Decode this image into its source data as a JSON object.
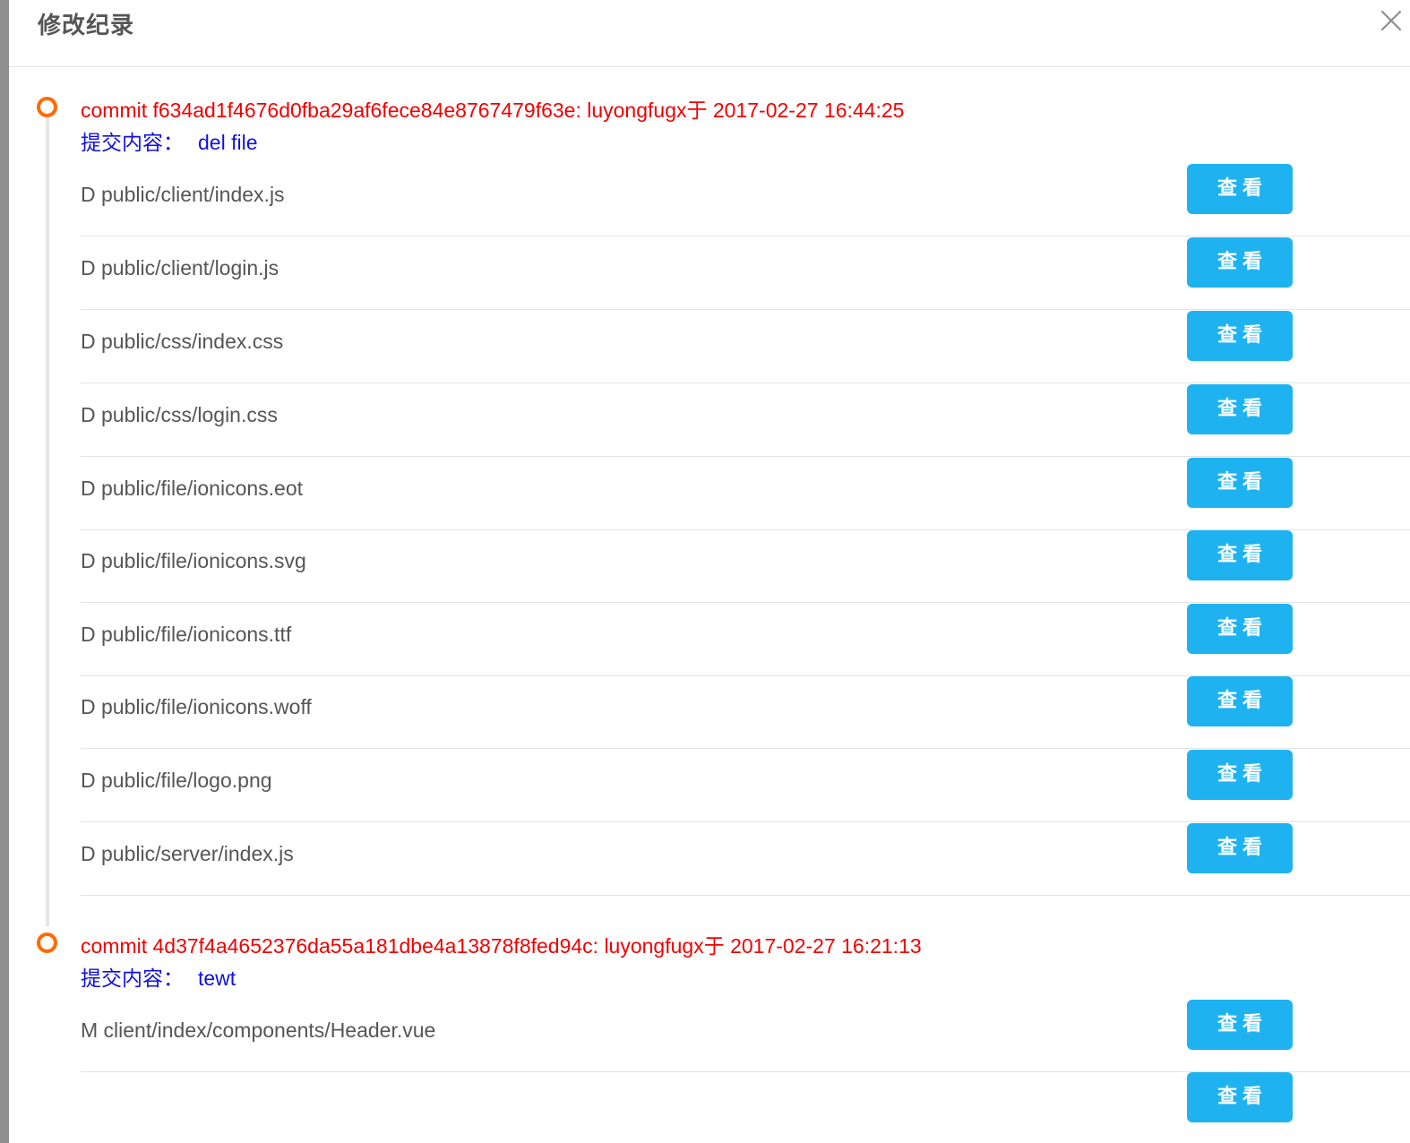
{
  "dialog": {
    "title": "修改纪录"
  },
  "commits": [
    {
      "header": "commit f634ad1f4676d0fba29af6fece84e8767479f63e: luyongfugx于 2017-02-27 16:44:25",
      "message_label": "提交内容：",
      "message": "del file",
      "files": [
        {
          "name": "D public/client/index.js",
          "button": "查看"
        },
        {
          "name": "D public/client/login.js",
          "button": "查看"
        },
        {
          "name": "D public/css/index.css",
          "button": "查看"
        },
        {
          "name": "D public/css/login.css",
          "button": "查看"
        },
        {
          "name": "D public/file/ionicons.eot",
          "button": "查看"
        },
        {
          "name": "D public/file/ionicons.svg",
          "button": "查看"
        },
        {
          "name": "D public/file/ionicons.ttf",
          "button": "查看"
        },
        {
          "name": "D public/file/ionicons.woff",
          "button": "查看"
        },
        {
          "name": "D public/file/logo.png",
          "button": "查看"
        },
        {
          "name": "D public/server/index.js",
          "button": "查看"
        }
      ]
    },
    {
      "header": "commit 4d37f4a4652376da55a181dbe4a13878f8fed94c: luyongfugx于 2017-02-27 16:21:13",
      "message_label": "提交内容：",
      "message": "tewt",
      "files": [
        {
          "name": "M client/index/components/Header.vue",
          "button": "查看"
        },
        {
          "name": "",
          "button": "查看"
        }
      ]
    }
  ],
  "colors": {
    "commit_text": "#f00000",
    "message_text": "#1010e0",
    "timeline_dot": "#ff6a00",
    "button_bg": "#1eb3f0"
  }
}
